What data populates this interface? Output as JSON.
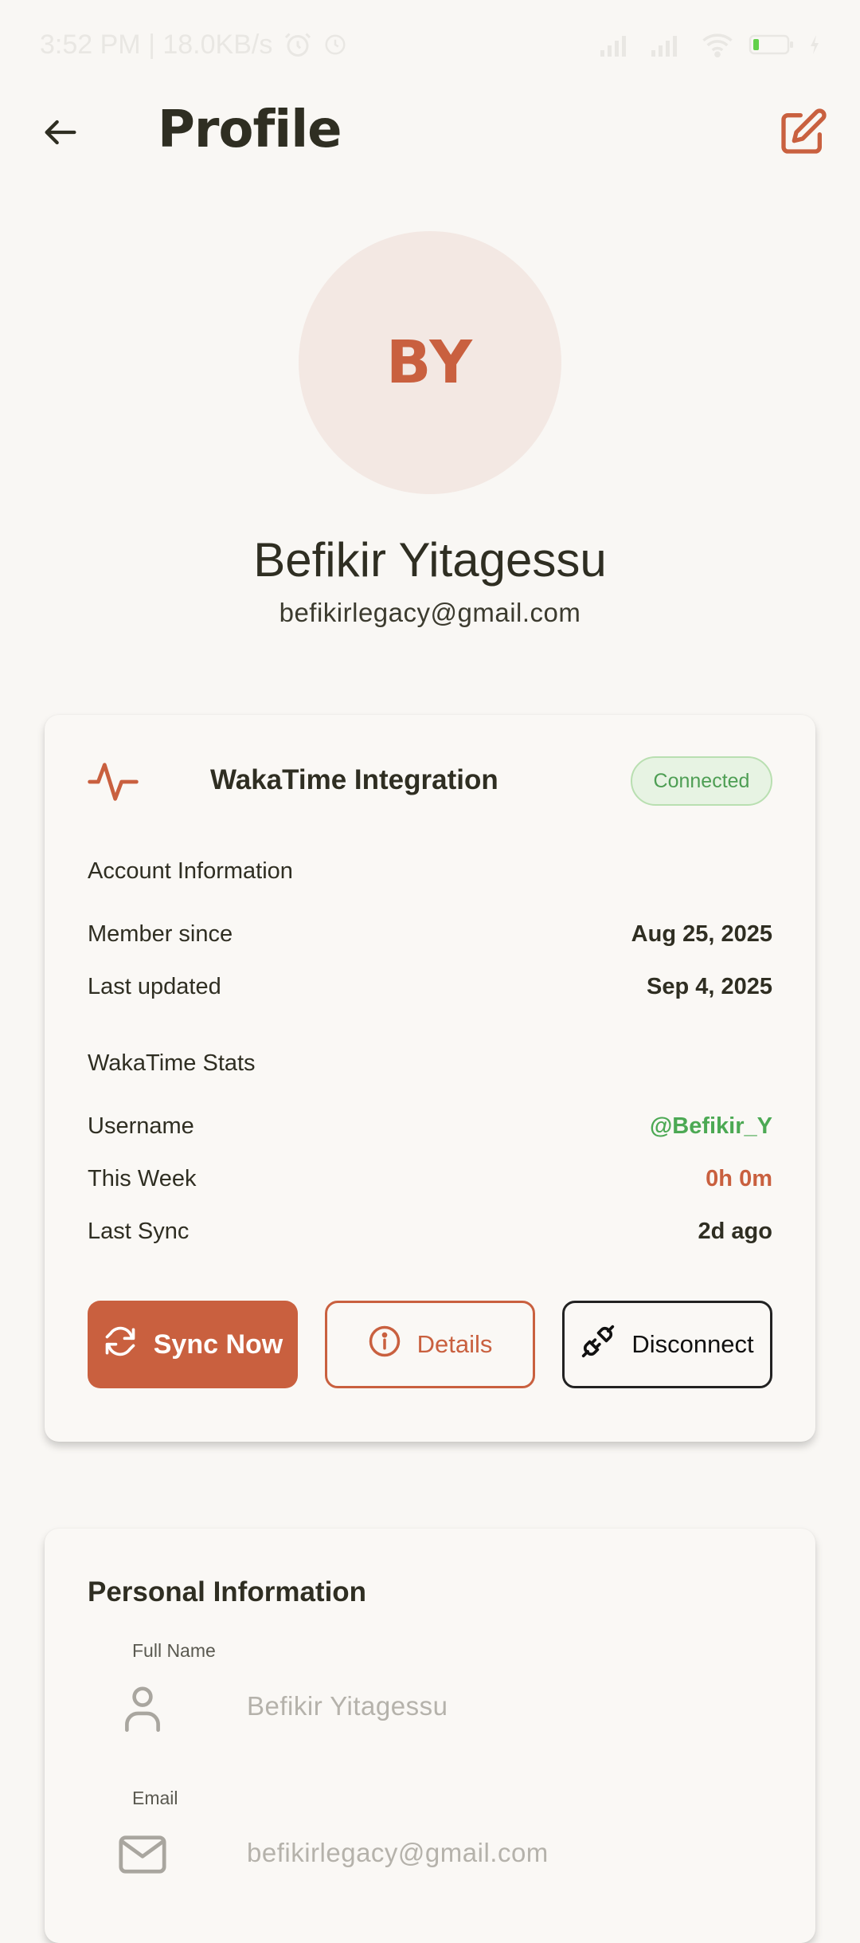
{
  "status_bar": {
    "time_text": "3:52 PM | 18.0KB/s",
    "icons": [
      "alarm-icon",
      "clock-icon",
      "signal-icon",
      "signal-icon",
      "wifi-icon",
      "battery-icon",
      "charging-icon"
    ]
  },
  "header": {
    "title": "Profile",
    "back_icon": "arrow-left-icon",
    "edit_icon": "edit-icon"
  },
  "profile": {
    "initials": "BY",
    "name": "Befikir Yitagessu",
    "email": "befikirlegacy@gmail.com"
  },
  "wakatime": {
    "title": "WakaTime Integration",
    "status": "Connected",
    "account_section": "Account Information",
    "member_since_label": "Member since",
    "member_since_value": "Aug 25, 2025",
    "last_updated_label": "Last updated",
    "last_updated_value": "Sep 4, 2025",
    "stats_section": "WakaTime Stats",
    "username_label": "Username",
    "username_value": "@Befikir_Y",
    "this_week_label": "This Week",
    "this_week_value": "0h 0m",
    "last_sync_label": "Last Sync",
    "last_sync_value": "2d ago",
    "sync_button": "Sync Now",
    "details_button": "Details",
    "disconnect_button": "Disconnect"
  },
  "personal": {
    "title": "Personal Information",
    "full_name_label": "Full Name",
    "full_name_value": "Befikir Yitagessu",
    "email_label": "Email",
    "email_value": "befikirlegacy@gmail.com"
  },
  "colors": {
    "accent": "#c9603f",
    "background": "#f9f7f4",
    "success": "#4ca954",
    "text": "#2f2e22"
  }
}
